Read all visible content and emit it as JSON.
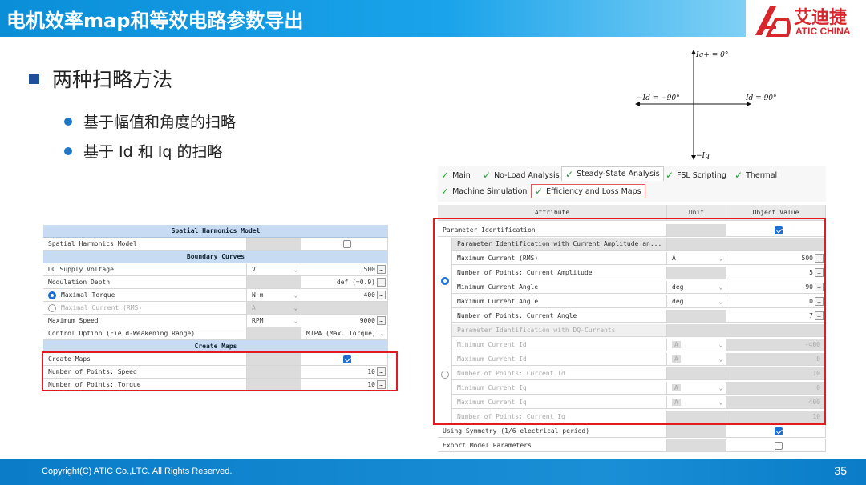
{
  "header": {
    "title": "电机效率map和等效电路参数导出",
    "logo_cn": "艾迪捷",
    "logo_en": "ATIC CHINA"
  },
  "bullets": {
    "main": "两种扫略方法",
    "subs": [
      "基于幅值和角度的扫略",
      "基于 Id 和 Iq 的扫略"
    ]
  },
  "axis": {
    "top": "Iq+ = 0°",
    "left": "−Id = −90°",
    "right": "Id = 90°",
    "bottom": "−Iq"
  },
  "left_table": {
    "section1": "Spatial Harmonics Model",
    "row_shm": "Spatial Harmonics Model",
    "section2": "Boundary Curves",
    "rows": [
      {
        "label": "DC Supply Voltage",
        "unit": "V",
        "value": "500"
      },
      {
        "label": "Modulation Depth",
        "unit": "",
        "value": "def (=0.9)"
      },
      {
        "label": "Maximal Torque",
        "unit": "N·m",
        "value": "400"
      },
      {
        "label": "Maximal Current (RMS)",
        "unit": "A",
        "value": ""
      },
      {
        "label": "Maximum Speed",
        "unit": "RPM",
        "value": "9000"
      },
      {
        "label": "Control Option (Field-Weakening Range)",
        "unit": "",
        "value": "MTPA (Max. Torque)"
      }
    ],
    "section3": "Create Maps",
    "maps_rows": [
      {
        "label": "Create Maps",
        "value": ""
      },
      {
        "label": "Number of Points: Speed",
        "value": "10"
      },
      {
        "label": "Number of Points: Torque",
        "value": "10"
      }
    ]
  },
  "tabs": {
    "row1": [
      "Main",
      "No-Load Analysis",
      "Steady-State Analysis",
      "FSL Scripting",
      "Thermal"
    ],
    "row2": [
      "Machine Simulation",
      "Efficiency and Loss Maps"
    ]
  },
  "right_table": {
    "headers": [
      "Attribute",
      "Unit",
      "Object Value"
    ],
    "param_id": "Parameter Identification",
    "group1_title": "Parameter Identification with Current Amplitude an...",
    "group1_rows": [
      {
        "label": "Maximum Current (RMS)",
        "unit": "A",
        "value": "500"
      },
      {
        "label": "Number of Points: Current Amplitude",
        "unit": "",
        "value": "5"
      },
      {
        "label": "Minimum Current Angle",
        "unit": "deg",
        "value": "-90"
      },
      {
        "label": "Maximum Current Angle",
        "unit": "deg",
        "value": "0"
      },
      {
        "label": "Number of Points: Current Angle",
        "unit": "",
        "value": "7"
      }
    ],
    "group2_title": "Parameter Identification with DQ-Currents",
    "group2_rows": [
      {
        "label": "Minimum Current Id",
        "unit": "A",
        "value": "-400"
      },
      {
        "label": "Maximum Current Id",
        "unit": "A",
        "value": "0"
      },
      {
        "label": "Number of Points: Current Id",
        "unit": "",
        "value": "10"
      },
      {
        "label": "Minimum Current Iq",
        "unit": "A",
        "value": "0"
      },
      {
        "label": "Maximum Current Iq",
        "unit": "A",
        "value": "400"
      },
      {
        "label": "Number of Points: Current Iq",
        "unit": "",
        "value": "10"
      }
    ],
    "symmetry": "Using Symmetry (1/6 electrical period)",
    "export": "Export Model Parameters"
  },
  "footer": {
    "copyright": "Copyright(C) ATIC Co.,LTC. All Rights Reserved.",
    "page": "35"
  },
  "colors": {
    "header_blue": "#0a8ed8",
    "highlight_red": "#e01b22",
    "check_green": "#2a9d3a",
    "section_blue": "#c7dcf2"
  }
}
